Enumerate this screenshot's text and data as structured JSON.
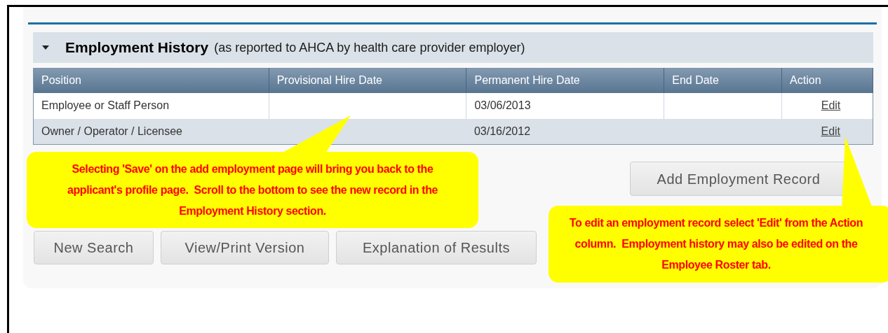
{
  "section": {
    "title": "Employment History",
    "subtitle": "(as reported to AHCA by health care provider employer)",
    "expanded": true
  },
  "table": {
    "columns": [
      "Position",
      "Provisional Hire Date",
      "Permanent Hire Date",
      "End Date",
      "Action"
    ],
    "rows": [
      {
        "position": "Employee or Staff Person",
        "provisional_hire_date": "",
        "permanent_hire_date": "03/06/2013",
        "end_date": "",
        "action": "Edit"
      },
      {
        "position": "Owner / Operator / Licensee",
        "provisional_hire_date": "",
        "permanent_hire_date": "03/16/2012",
        "end_date": "",
        "action": "Edit"
      }
    ]
  },
  "add_button": "Add Employment Record",
  "buttons": [
    "New Search",
    "View/Print Version",
    "Explanation of Results"
  ],
  "callouts": [
    {
      "text": "Selecting 'Save' on the add employment page will bring you back to the applicant's profile page.  Scroll to the bottom to see the new record in the Employment History section."
    },
    {
      "text": "To edit an employment record select 'Edit' from the Action column.  Employment history may also be edited on the Employee Roster tab."
    }
  ]
}
